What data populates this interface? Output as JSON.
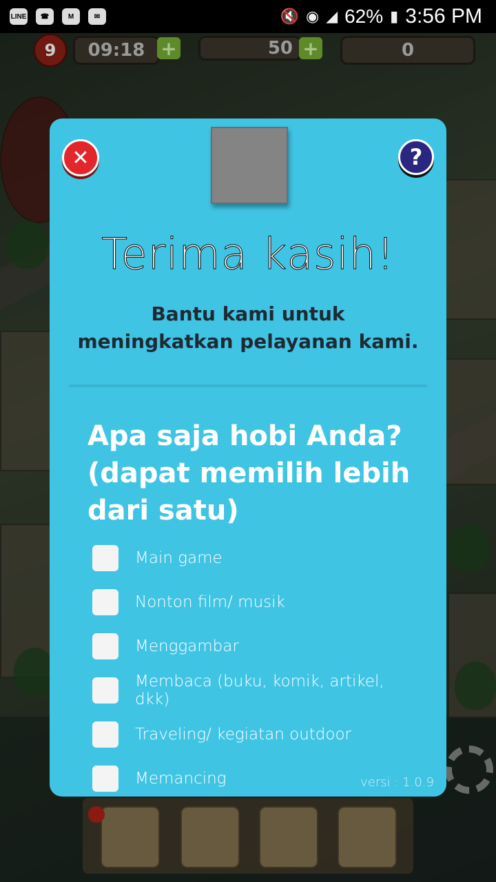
{
  "status_bar": {
    "app_icons": [
      "LINE",
      "whatsapp-icon",
      "gmail-icon",
      "message-icon"
    ],
    "battery_pct": "62%",
    "time": "3:56 PM"
  },
  "hud": {
    "level": "9",
    "timer": "09:18",
    "currency1": "50",
    "currency2": "0"
  },
  "dialog": {
    "title": "Terima kasih!",
    "subtitle": "Bantu kami untuk meningkatkan pelayanan kami.",
    "question": "Apa saja hobi Anda? (dapat memilih lebih dari satu)",
    "options": [
      "Main game",
      "Nonton film/ musik",
      "Menggambar",
      "Membaca (buku, komik, artikel, dkk)",
      "Traveling/ kegiatan outdoor",
      "Memancing"
    ],
    "version": "versi : 1.0.9",
    "close_icon": "✕",
    "help_icon": "?"
  },
  "colors": {
    "dialog_bg": "#40c4e4",
    "close_red": "#e2262b",
    "help_navy": "#2a2780"
  }
}
